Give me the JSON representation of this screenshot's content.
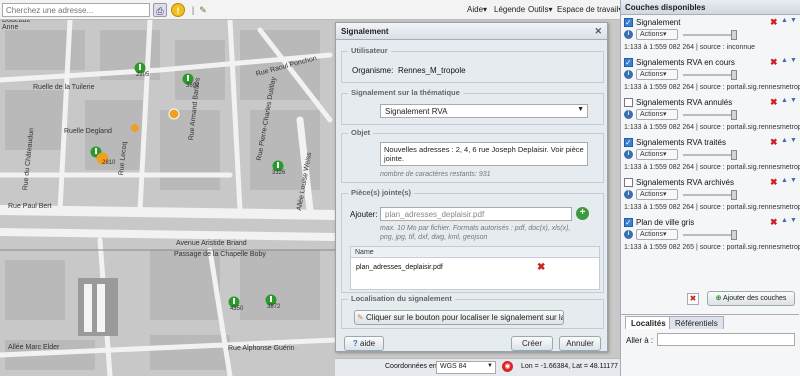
{
  "toolbar": {
    "search_placeholder": "Cherchez une adresse...",
    "menu_aide": "Aide",
    "menu_legende": "Légende",
    "menu_outils": "Outils",
    "menu_espace": "Espace de travail"
  },
  "map": {
    "streets": [
      "Ruelle de la Tuilerie",
      "Rue Raoul Ponchon",
      "Ruelle Degland",
      "Rue du Châteaudun",
      "Rue Paul Bert",
      "Rue Armand Barbès",
      "Allée Louise Weiss",
      "Avenue Aristide Briand",
      "Passage de la Chapelle Boby",
      "Allée Marc Elder",
      "Rue Alphonse Guérin",
      "Rue Pierre-Charles Dutillay",
      "Rue Lecoq",
      "Dudeault",
      "Anne"
    ],
    "markers": [
      "2205",
      "3692",
      "3126",
      "2810",
      "4350",
      "3872"
    ]
  },
  "dialog": {
    "title": "Signalement",
    "utilisateur_legend": "Utilisateur",
    "organisme_label": "Organisme:",
    "organisme_value": "Rennes_M_tropole",
    "thematique_legend": "Signalement sur la thématique",
    "thematique_value": "Signalement RVA",
    "objet_legend": "Objet",
    "objet_text_1": "Nouvelles adresses : 2, 4, 6 rue Joseph Deplaisir. Voir pièce",
    "objet_text_2": "jointe.",
    "chars_remaining": "nombre de caractères restants: 931",
    "pieces_legend": "Pièce(s) jointe(s)",
    "ajouter_label": "Ajouter:",
    "file_value": "plan_adresses_deplaisir.pdf",
    "file_hint_1": "max. 10 Mo par fichier. Formats autorisés : pdf, doc(x), xls(x),",
    "file_hint_2": "png, jpg, tif, dxf, dwg, kml, geojson",
    "table_header": "Name",
    "table_row": "plan_adresses_deplaisir.pdf",
    "localisation_legend": "Localisation du signalement",
    "localiser_button": "Cliquer sur le bouton pour localiser le signalement sur la carte",
    "aide_button": "aide",
    "creer_button": "Créer",
    "annuler_button": "Annuler"
  },
  "statusbar": {
    "coords_label": "Coordonnées en",
    "coords_system": "WGS 84",
    "lonlat": "Lon = -1.66384, Lat = 48.11177"
  },
  "layers_panel": {
    "title": "Couches disponibles",
    "actions_label": "Actions",
    "layers": [
      {
        "name": "Signalement",
        "checked": true,
        "scale": "1:133 à 1:559 082 264",
        "source": "source : inconnue"
      },
      {
        "name": "Signalements RVA en cours",
        "checked": true,
        "scale": "1:133 à 1:559 082 264",
        "source": "source : portail.sig.rennesmetrop..."
      },
      {
        "name": "Signalements RVA annulés",
        "checked": false,
        "scale": "1:133 à 1:559 082 264",
        "source": "source : portail.sig.rennesmetrop..."
      },
      {
        "name": "Signalements RVA traités",
        "checked": true,
        "scale": "1:133 à 1:559 082 264",
        "source": "source : portail.sig.rennesmetrop..."
      },
      {
        "name": "Signalements RVA archivés",
        "checked": false,
        "scale": "1:133 à 1:559 082 264",
        "source": "source : portail.sig.rennesmetrop..."
      },
      {
        "name": "Plan de ville gris",
        "checked": true,
        "scale": "1:133 à 1:559 082 265",
        "source": "source : portail.sig.rennesmetrop..."
      }
    ],
    "add_button": "Ajouter des couches",
    "tab_localites": "Localités",
    "tab_referentiels": "Référentiels",
    "aller_label": "Aller à :"
  },
  "colors": {
    "accent": "#3a7fd5",
    "marker_green": "#2a9a2a",
    "marker_orange": "#f0a020",
    "remove_red": "#cc2222"
  }
}
